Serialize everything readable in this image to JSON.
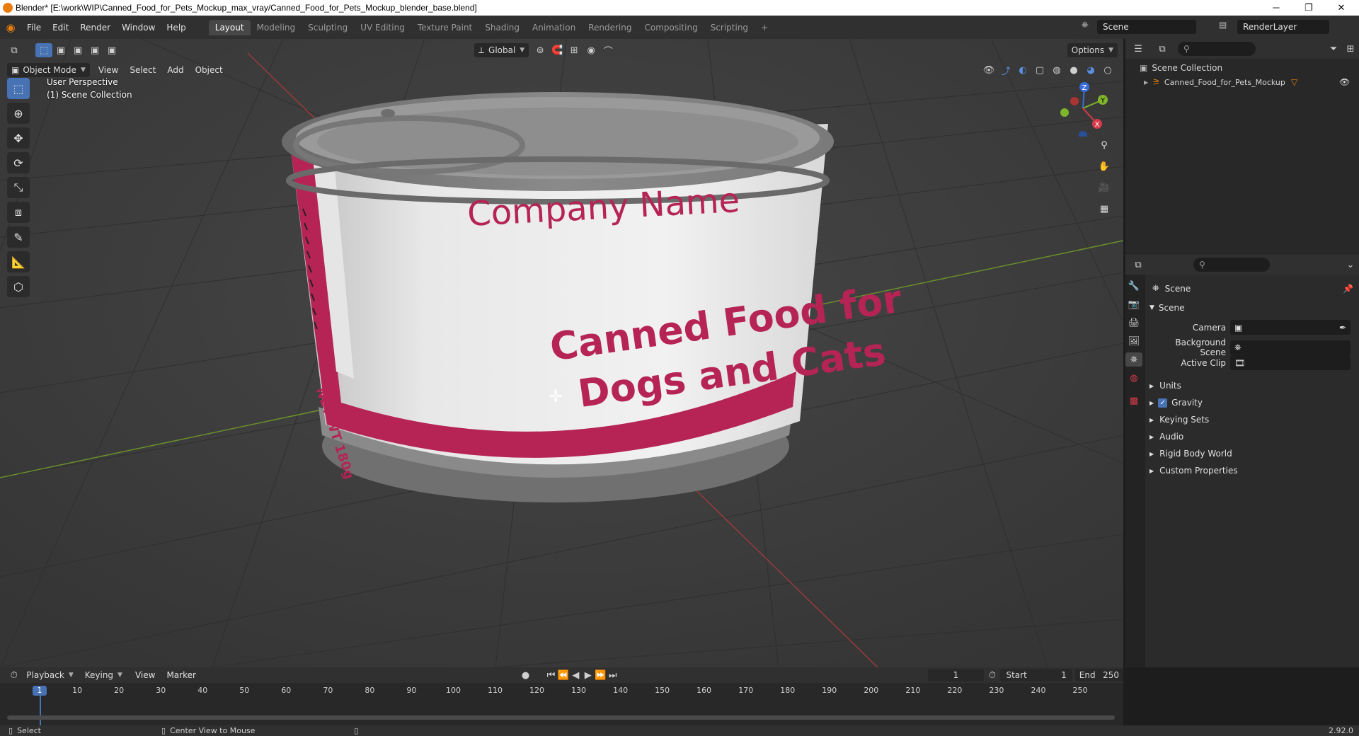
{
  "window": {
    "title": "Blender* [E:\\work\\WIP\\Canned_Food_for_Pets_Mockup_max_vray/Canned_Food_for_Pets_Mockup_blender_base.blend]",
    "minimize": "─",
    "restore": "❐",
    "close": "✕"
  },
  "menu": [
    "File",
    "Edit",
    "Render",
    "Window",
    "Help"
  ],
  "workspaces": [
    "Layout",
    "Modeling",
    "Sculpting",
    "UV Editing",
    "Texture Paint",
    "Shading",
    "Animation",
    "Rendering",
    "Compositing",
    "Scripting"
  ],
  "add_workspace": "+",
  "scene_selector": "Scene",
  "view_layer": "RenderLayer",
  "viewport": {
    "orientation": "Global",
    "options": "Options",
    "mode": "Object Mode",
    "header_menu": [
      "View",
      "Select",
      "Add",
      "Object"
    ],
    "overlay_line1": "User Perspective",
    "overlay_line2": "(1) Scene Collection",
    "gizmo": {
      "x": "X",
      "y": "Y",
      "z": "Z"
    }
  },
  "can_label": {
    "company": "Company Name",
    "product_line1": "Canned Food for",
    "product_line2": "Dogs and Cats",
    "net_weight": "NET WT 180g"
  },
  "outliner": {
    "root": "Scene Collection",
    "items": [
      {
        "label": "Canned_Food_for_Pets_Mockup"
      }
    ]
  },
  "properties": {
    "context": "Scene",
    "panel_title": "Scene",
    "fields": [
      {
        "label": "Camera"
      },
      {
        "label": "Background Scene"
      },
      {
        "label": "Active Clip"
      }
    ],
    "sections": [
      {
        "label": "Units",
        "checkbox": false
      },
      {
        "label": "Gravity",
        "checkbox": true
      },
      {
        "label": "Keying Sets",
        "checkbox": false
      },
      {
        "label": "Audio",
        "checkbox": false
      },
      {
        "label": "Rigid Body World",
        "checkbox": false
      },
      {
        "label": "Custom Properties",
        "checkbox": false
      }
    ]
  },
  "timeline": {
    "menu": [
      "Playback",
      "Keying",
      "View",
      "Marker"
    ],
    "current_frame": "1",
    "start_label": "Start",
    "start": "1",
    "end_label": "End",
    "end": "250",
    "ticks": [
      "1",
      "10",
      "20",
      "30",
      "40",
      "50",
      "60",
      "70",
      "80",
      "90",
      "100",
      "110",
      "120",
      "130",
      "140",
      "150",
      "160",
      "170",
      "180",
      "190",
      "200",
      "210",
      "220",
      "230",
      "240",
      "250"
    ]
  },
  "statusbar": {
    "select": "Select",
    "center_view": "Center View to Mouse",
    "version": "2.92.0"
  },
  "colors": {
    "accent": "#4772b3",
    "label_pink": "#b52454",
    "viewport_bg": "#3d3d3d"
  }
}
